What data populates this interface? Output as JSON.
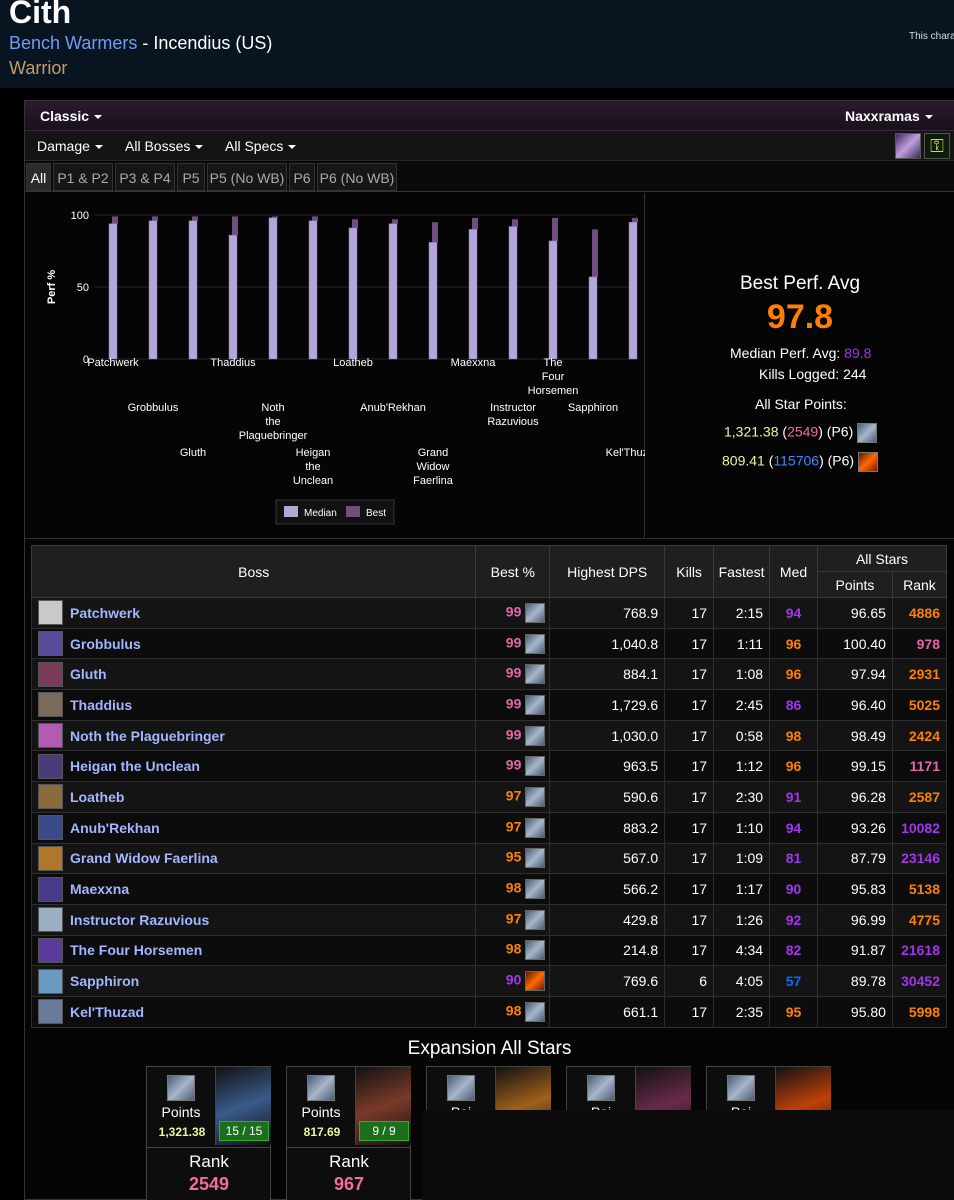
{
  "header": {
    "char_name": "Cith",
    "guild": "Bench Warmers",
    "separator": " - ",
    "realm": "Incendius (US)",
    "class_name": "Warrior",
    "notice": "This chara"
  },
  "filters": {
    "version": "Classic",
    "zone": "Naxxramas",
    "metric": "Damage",
    "bosses": "All Bosses",
    "specs": "All Specs"
  },
  "tabs": [
    "All",
    "P1 & P2",
    "P3 & P4",
    "P5",
    "P5 (No WB)",
    "P6",
    "P6 (No WB)"
  ],
  "summary": {
    "best_perf_label": "Best Perf. Avg",
    "best_perf_value": "97.8",
    "median_label": "Median Perf. Avg:",
    "median_value": "89.8",
    "kills_label": "Kills Logged:",
    "kills_value": "244",
    "allstar_label": "All Star Points:",
    "allstar1_points": "1,321.38",
    "allstar1_rank": "2549",
    "allstar1_phase": "(P6)",
    "allstar2_points": "809.41",
    "allstar2_rank": "115706",
    "allstar2_phase": "(P6)"
  },
  "chart_data": {
    "type": "bar",
    "ylabel": "Perf %",
    "ylim": [
      0,
      100
    ],
    "yticks": [
      "0",
      "50",
      "100"
    ],
    "categories": [
      "Patchwerk",
      "Grobbulus",
      "Gluth",
      "Thaddius",
      "Noth the Plaguebringer",
      "Heigan the Unclean",
      "Loatheb",
      "Anub'Rekhan",
      "Grand Widow Faerlina",
      "Maexxna",
      "Instructor Razuvious",
      "The Four Horsemen",
      "Sapphiron",
      "Kel'Thuzad"
    ],
    "series": [
      {
        "name": "Median",
        "color": "#b3a6d9",
        "values": [
          94,
          96,
          96,
          86,
          98,
          96,
          91,
          94,
          81,
          90,
          92,
          82,
          57,
          95
        ]
      },
      {
        "name": "Best",
        "color": "#6e4f7d",
        "values": [
          99,
          99,
          99,
          99,
          99,
          99,
          97,
          97,
          95,
          98,
          97,
          98,
          90,
          98
        ]
      }
    ],
    "legend": "bottom"
  },
  "table": {
    "headers": {
      "boss": "Boss",
      "best": "Best %",
      "dps": "Highest DPS",
      "kills": "Kills",
      "fastest": "Fastest",
      "med": "Med",
      "allstars": "All Stars",
      "points": "Points",
      "rank": "Rank"
    },
    "rows": [
      {
        "boss": "Patchwerk",
        "best": "99",
        "dps": "768.9",
        "kills": "17",
        "fastest": "2:15",
        "med": "94",
        "points": "96.65",
        "rank": "4886",
        "icon_color": "#c9c9c9"
      },
      {
        "boss": "Grobbulus",
        "best": "99",
        "dps": "1,040.8",
        "kills": "17",
        "fastest": "1:11",
        "med": "96",
        "points": "100.40",
        "rank": "978",
        "icon_color": "#5a4a9a"
      },
      {
        "boss": "Gluth",
        "best": "99",
        "dps": "884.1",
        "kills": "17",
        "fastest": "1:08",
        "med": "96",
        "points": "97.94",
        "rank": "2931",
        "icon_color": "#7a3a5a"
      },
      {
        "boss": "Thaddius",
        "best": "99",
        "dps": "1,729.6",
        "kills": "17",
        "fastest": "2:45",
        "med": "86",
        "points": "96.40",
        "rank": "5025",
        "icon_color": "#7a6a5a"
      },
      {
        "boss": "Noth the Plaguebringer",
        "best": "99",
        "dps": "1,030.0",
        "kills": "17",
        "fastest": "0:58",
        "med": "98",
        "points": "98.49",
        "rank": "2424",
        "icon_color": "#b35ab3"
      },
      {
        "boss": "Heigan the Unclean",
        "best": "99",
        "dps": "963.5",
        "kills": "17",
        "fastest": "1:12",
        "med": "96",
        "points": "99.15",
        "rank": "1171",
        "icon_color": "#4a3a7a"
      },
      {
        "boss": "Loatheb",
        "best": "97",
        "dps": "590.6",
        "kills": "17",
        "fastest": "2:30",
        "med": "91",
        "points": "96.28",
        "rank": "2587",
        "icon_color": "#8a6a3a"
      },
      {
        "boss": "Anub'Rekhan",
        "best": "97",
        "dps": "883.2",
        "kills": "17",
        "fastest": "1:10",
        "med": "94",
        "points": "93.26",
        "rank": "10082",
        "icon_color": "#3a4a8a"
      },
      {
        "boss": "Grand Widow Faerlina",
        "best": "95",
        "dps": "567.0",
        "kills": "17",
        "fastest": "1:09",
        "med": "81",
        "points": "87.79",
        "rank": "23146",
        "icon_color": "#b0762a"
      },
      {
        "boss": "Maexxna",
        "best": "98",
        "dps": "566.2",
        "kills": "17",
        "fastest": "1:17",
        "med": "90",
        "points": "95.83",
        "rank": "5138",
        "icon_color": "#4a3a8a"
      },
      {
        "boss": "Instructor Razuvious",
        "best": "97",
        "dps": "429.8",
        "kills": "17",
        "fastest": "1:26",
        "med": "92",
        "points": "96.99",
        "rank": "4775",
        "icon_color": "#9ab0c0"
      },
      {
        "boss": "The Four Horsemen",
        "best": "98",
        "dps": "214.8",
        "kills": "17",
        "fastest": "4:34",
        "med": "82",
        "points": "91.87",
        "rank": "21618",
        "icon_color": "#5a3a9a"
      },
      {
        "boss": "Sapphiron",
        "best": "90",
        "dps": "769.6",
        "kills": "6",
        "fastest": "4:05",
        "med": "57",
        "points": "89.78",
        "rank": "30452",
        "icon_color": "#6a9ac0"
      },
      {
        "boss": "Kel'Thuzad",
        "best": "98",
        "dps": "661.1",
        "kills": "17",
        "fastest": "2:35",
        "med": "95",
        "points": "95.80",
        "rank": "5998",
        "icon_color": "#6a7a9a"
      }
    ]
  },
  "expansion": {
    "title": "Expansion All Stars",
    "cards": [
      {
        "points_label": "Points",
        "points": "1,321.38",
        "kills": "15 / 15",
        "rank_label": "Rank",
        "rank": "2549",
        "img_color": "#3a5a8a"
      },
      {
        "points_label": "Points",
        "points": "817.69",
        "kills": "9 / 9",
        "rank_label": "Rank",
        "rank": "967",
        "img_color": "#7a3a2a"
      },
      {
        "points_label": "Poi",
        "img_color": "#a0601a"
      },
      {
        "points_label": "Poi",
        "img_color": "#6a2a4a"
      },
      {
        "points_label": "Poi",
        "img_color": "#c0400a"
      }
    ]
  },
  "colors": {
    "orange": "#ff8000",
    "pink": "#e268a8",
    "purple": "#a335ee",
    "blue": "#0070ff",
    "gold": "#e5cc80",
    "green": "#1eff00"
  }
}
